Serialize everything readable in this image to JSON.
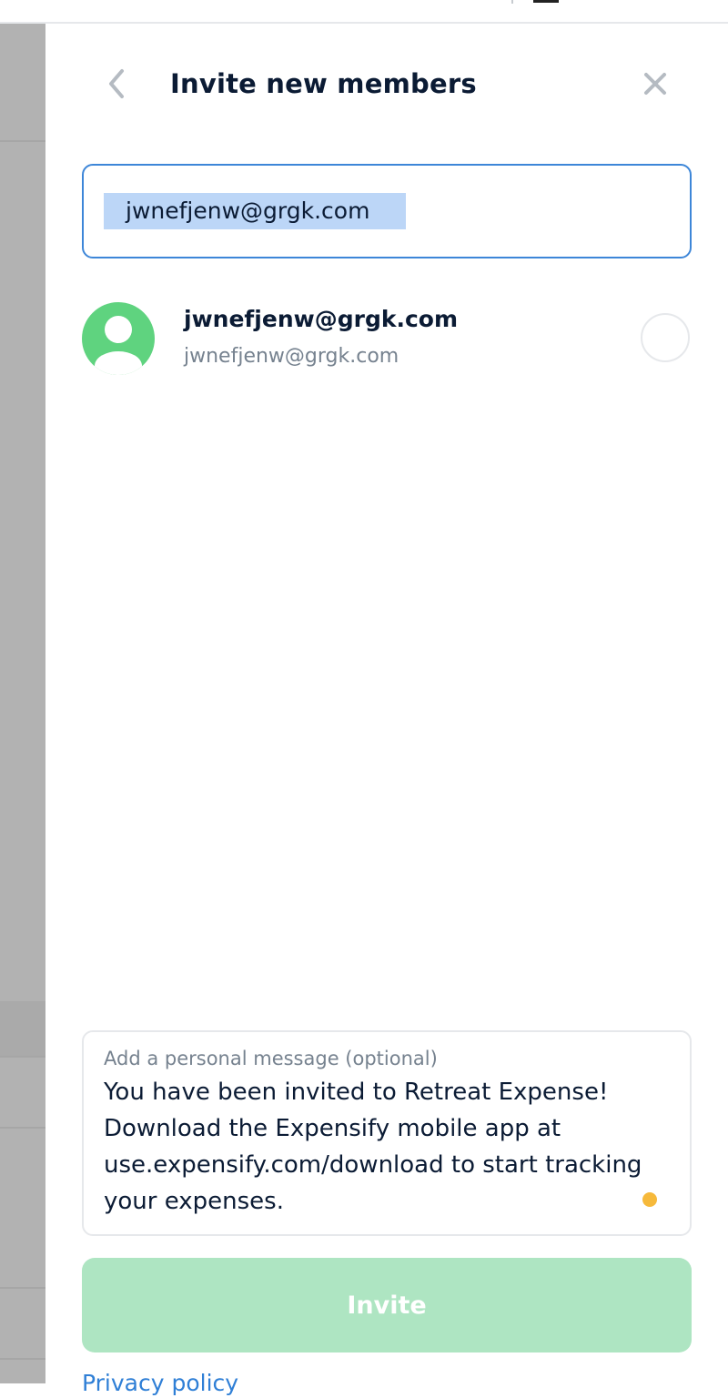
{
  "header": {
    "title": "Invite new members",
    "back_icon": "chevron-left-icon",
    "close_icon": "close-icon"
  },
  "search": {
    "value": "jwnefjenw@grgk.com"
  },
  "members": [
    {
      "name": "jwnefjenw@grgk.com",
      "subtitle": "jwnefjenw@grgk.com",
      "avatar_icon": "default-avatar-icon",
      "selected": false
    }
  ],
  "message": {
    "label": "Add a personal message (optional)",
    "text": "You have been invited to Retreat Expense! Download the Expensify mobile app at use.expensify.com/download to start tracking your expenses."
  },
  "actions": {
    "invite_label": "Invite",
    "privacy_link": "Privacy policy"
  },
  "colors": {
    "accent": "#3d86d8",
    "avatar": "#5fd37f",
    "invite_disabled": "#aee5c2",
    "link": "#2f7fd6",
    "indicator": "#f6b93b"
  }
}
